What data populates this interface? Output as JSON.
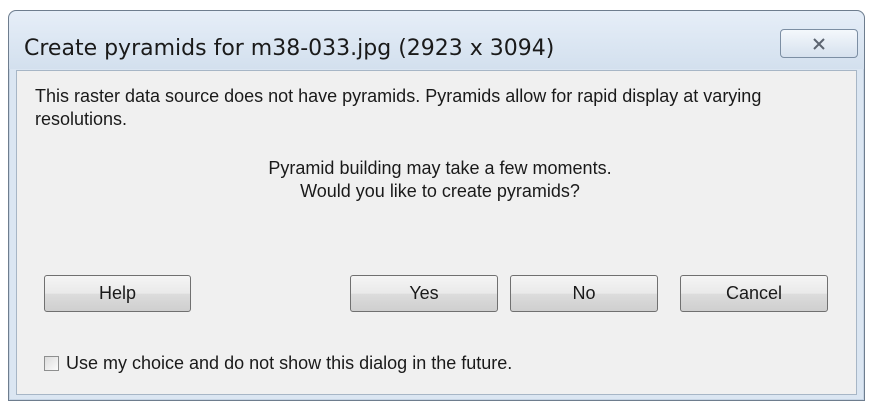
{
  "window": {
    "title": "Create pyramids for m38-033.jpg (2923 x 3094)",
    "close_icon": "close-x-icon"
  },
  "message": {
    "line1": "This raster data source does not have pyramids. Pyramids allow for rapid display at varying resolutions.",
    "line2": "Pyramid building may take a few moments.",
    "line3": "Would you like to create pyramids?"
  },
  "buttons": {
    "help": "Help",
    "yes": "Yes",
    "no": "No",
    "cancel": "Cancel"
  },
  "checkbox": {
    "label": "Use my choice and do not show this dialog in the future.",
    "checked": false
  }
}
